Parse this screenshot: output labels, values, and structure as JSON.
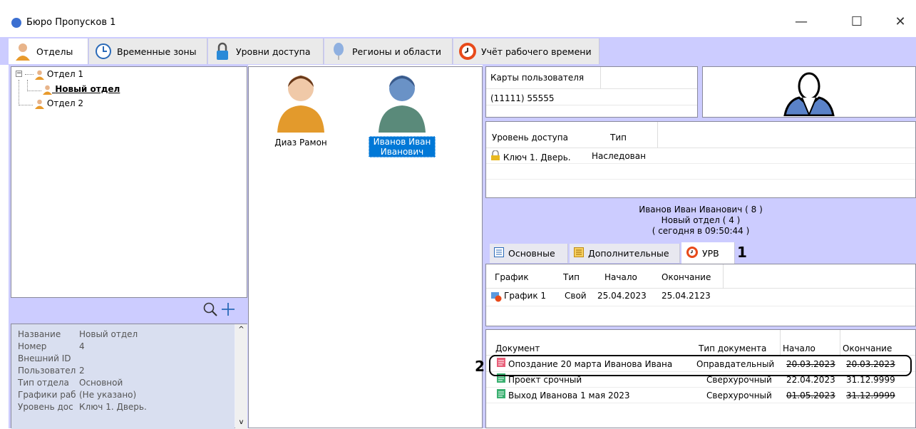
{
  "window": {
    "title": "Бюро Пропусков 1",
    "minimize": "—",
    "maximize": "☐",
    "close": "✕"
  },
  "tabs": [
    {
      "label": "Отделы",
      "icon": "person-icon"
    },
    {
      "label": "Временные зоны",
      "icon": "clock-icon"
    },
    {
      "label": "Уровни доступа",
      "icon": "padlock-icon"
    },
    {
      "label": "Регионы и области",
      "icon": "balloon-icon"
    },
    {
      "label": "Учёт рабочего времени",
      "icon": "stopwatch-icon"
    }
  ],
  "tree": {
    "root": "Отдел 1",
    "child": "Новый отдел",
    "sibling": "Отдел 2"
  },
  "persons": [
    {
      "name": "Диаз Рамон"
    },
    {
      "name_line1": "Иванов Иван",
      "name_line2": "Иванович"
    }
  ],
  "properties": [
    {
      "key": "Название",
      "value": "Новый отдел"
    },
    {
      "key": "Номер",
      "value": "4"
    },
    {
      "key": "Внешний ID",
      "value": ""
    },
    {
      "key": "Пользовател",
      "value": "2"
    },
    {
      "key": "Тип отдела",
      "value": "Основной"
    },
    {
      "key": "Графики раб",
      "value": "(Не указано)"
    },
    {
      "key": "Уровень дос",
      "value": "Ключ 1. Дверь."
    }
  ],
  "cards": {
    "header": "Карты пользователя",
    "value": "(11111) 55555"
  },
  "access": {
    "col1": "Уровень доступа",
    "col2": "Тип",
    "row_level": "Ключ 1. Дверь.",
    "row_type": "Наследован"
  },
  "user_info": {
    "line1": "Иванов Иван Иванович ( 8 )",
    "line2": "Новый отдел ( 4 )",
    "line3": "( сегодня в 09:50:44 )"
  },
  "subtabs": [
    {
      "label": "Основные"
    },
    {
      "label": "Дополнительные"
    },
    {
      "label": "УРВ"
    }
  ],
  "callouts": {
    "one": "1",
    "two": "2"
  },
  "schedule": {
    "headers": [
      "График",
      "Тип",
      "Начало",
      "Окончание"
    ],
    "row": [
      "График 1",
      "Свой",
      "25.04.2023",
      "25.04.2123"
    ]
  },
  "documents": {
    "headers": [
      "Документ",
      "Тип документа",
      "Начало",
      "Окончание"
    ],
    "rows": [
      [
        "Опоздание 20 марта Иванова Ивана",
        "Оправдательный",
        "20.03.2023",
        "20.03.2023"
      ],
      [
        "Проект срочный",
        "Сверхурочный",
        "22.04.2023",
        "31.12.9999"
      ],
      [
        "Выход Иванова 1 мая 2023",
        "Сверхурочный",
        "01.05.2023",
        "31.12.9999"
      ]
    ]
  },
  "colors": {
    "lavender": "#ccccff",
    "selection": "#0078d7",
    "callout_border": "#000000"
  }
}
